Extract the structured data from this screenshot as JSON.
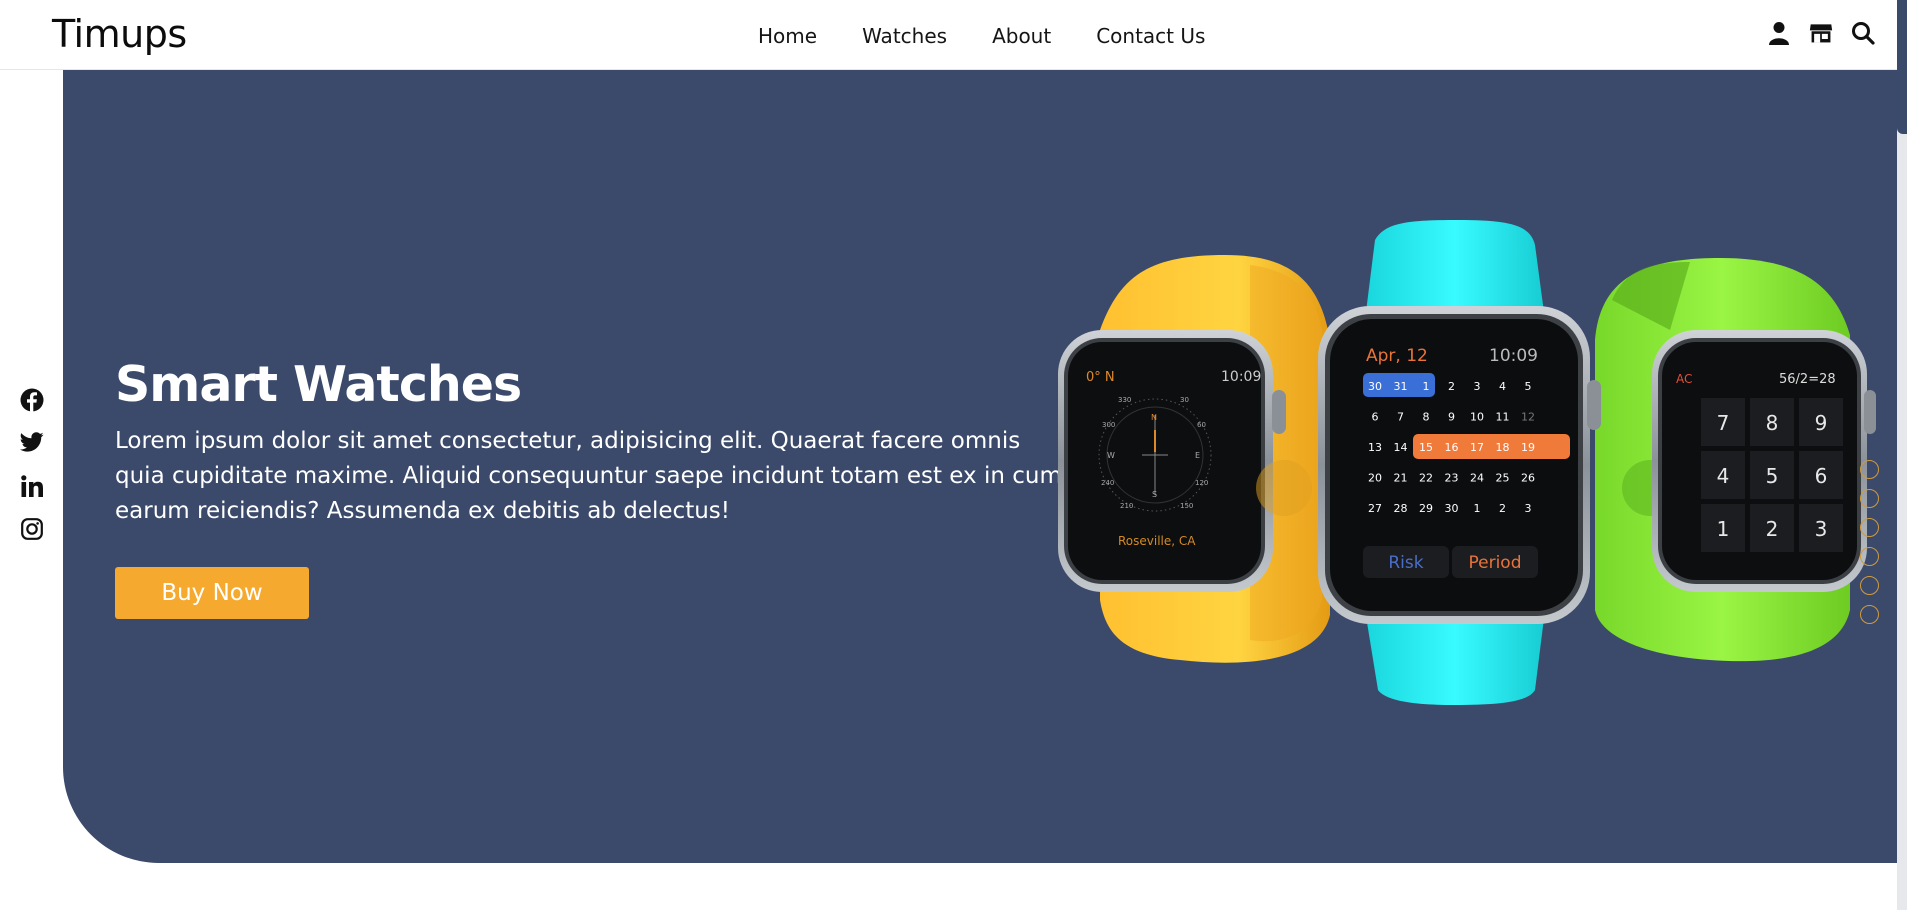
{
  "header": {
    "logo": "Timups",
    "nav": [
      "Home",
      "Watches",
      "About",
      "Contact Us"
    ]
  },
  "icons": {
    "header": [
      "user-icon",
      "store-icon",
      "search-icon"
    ],
    "social": [
      "facebook-icon",
      "twitter-icon",
      "linkedin-icon",
      "instagram-icon"
    ]
  },
  "hero": {
    "title": "Smart Watches",
    "text": "Lorem ipsum dolor sit amet consectetur, adipisicing elit. Quaerat facere omnis quia cupiditate maxime. Aliquid consequuntur saepe incidunt totam est ex in cum earum reiciendis? Assumenda ex debitis ab delectus!",
    "button": "Buy Now",
    "slide_count": 6
  },
  "watch_screens": {
    "compass": {
      "heading": "0° N",
      "time": "10:09",
      "location": "Roseville, CA",
      "dial": [
        "N",
        "30",
        "60",
        "E",
        "120",
        "150",
        "S",
        "210",
        "240",
        "W",
        "300",
        "330"
      ]
    },
    "calendar": {
      "month": "Apr, 12",
      "time": "10:09",
      "rows": [
        [
          "30",
          "31",
          "1",
          "2",
          "3",
          "4",
          "5"
        ],
        [
          "6",
          "7",
          "8",
          "9",
          "10",
          "11",
          "12"
        ],
        [
          "13",
          "14",
          "15",
          "16",
          "17",
          "18",
          "19"
        ],
        [
          "20",
          "21",
          "22",
          "23",
          "24",
          "25",
          "26"
        ],
        [
          "27",
          "28",
          "29",
          "30",
          "1",
          "2",
          "3"
        ]
      ],
      "buttons": [
        "Risk",
        "Period"
      ]
    },
    "calculator": {
      "clear": "AC",
      "display": "56/2=28",
      "keys": [
        "7",
        "8",
        "9",
        "4",
        "5",
        "6",
        "1",
        "2",
        "3"
      ]
    }
  },
  "colors": {
    "hero_bg": "#3b4a6b",
    "accent": "#f5aa2f",
    "band_yellow": "#ffb020",
    "band_cyan": "#2ef0f5",
    "band_green": "#8ef23a",
    "calendar_blue": "#3a6fd8",
    "calendar_orange": "#f07a3a"
  }
}
